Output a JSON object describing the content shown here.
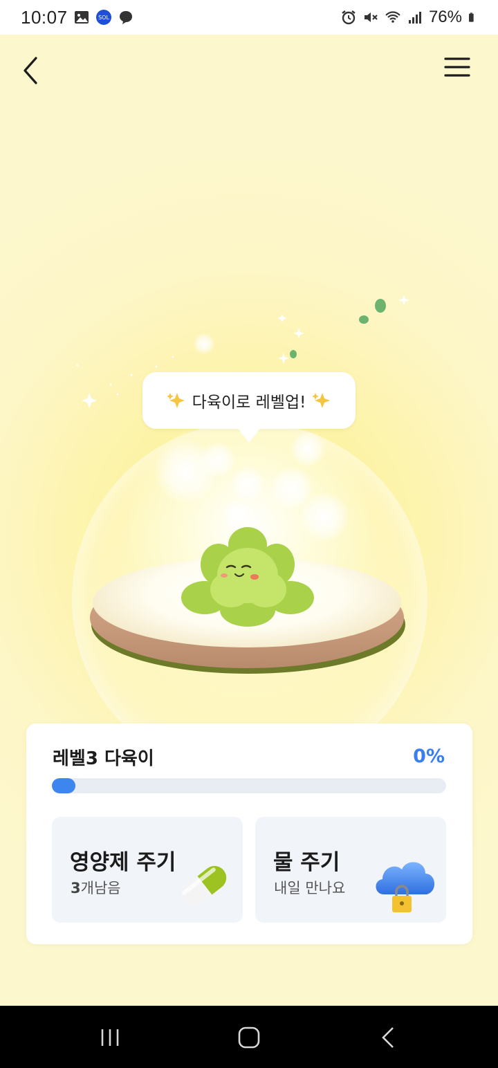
{
  "status_bar": {
    "time": "10:07",
    "battery_percent": "76%",
    "left_icons": [
      "gallery-icon",
      "super-sol-icon",
      "chat-bubble-icon"
    ],
    "right_icons": [
      "alarm-icon",
      "mute-icon",
      "wifi-icon",
      "signal-icon",
      "battery-icon"
    ]
  },
  "header": {
    "back_icon": "chevron-left-icon",
    "menu_icon": "hamburger-menu-icon"
  },
  "speech_bubble": {
    "text": "다육이로 레벨업!",
    "icon": "sparkles-icon"
  },
  "level_card": {
    "title": "레벨3 다육이",
    "percent_label": "0%",
    "progress": 0.06,
    "progress_color": "#3e86ef",
    "percent_color": "#3a7ef0"
  },
  "actions": [
    {
      "title": "영양제 주기",
      "count": "3",
      "sub": "개남음",
      "icon": "pill-icon"
    },
    {
      "title": "물 주기",
      "sub": "내일 만나요",
      "icon": "locked-cloud-icon"
    }
  ],
  "nav_bar": {
    "icons": [
      "recent-apps-icon",
      "home-icon",
      "back-icon"
    ]
  },
  "colors": {
    "background": "#fdf6c4",
    "card": "#ffffff",
    "action_tile": "#f1f4f9"
  }
}
